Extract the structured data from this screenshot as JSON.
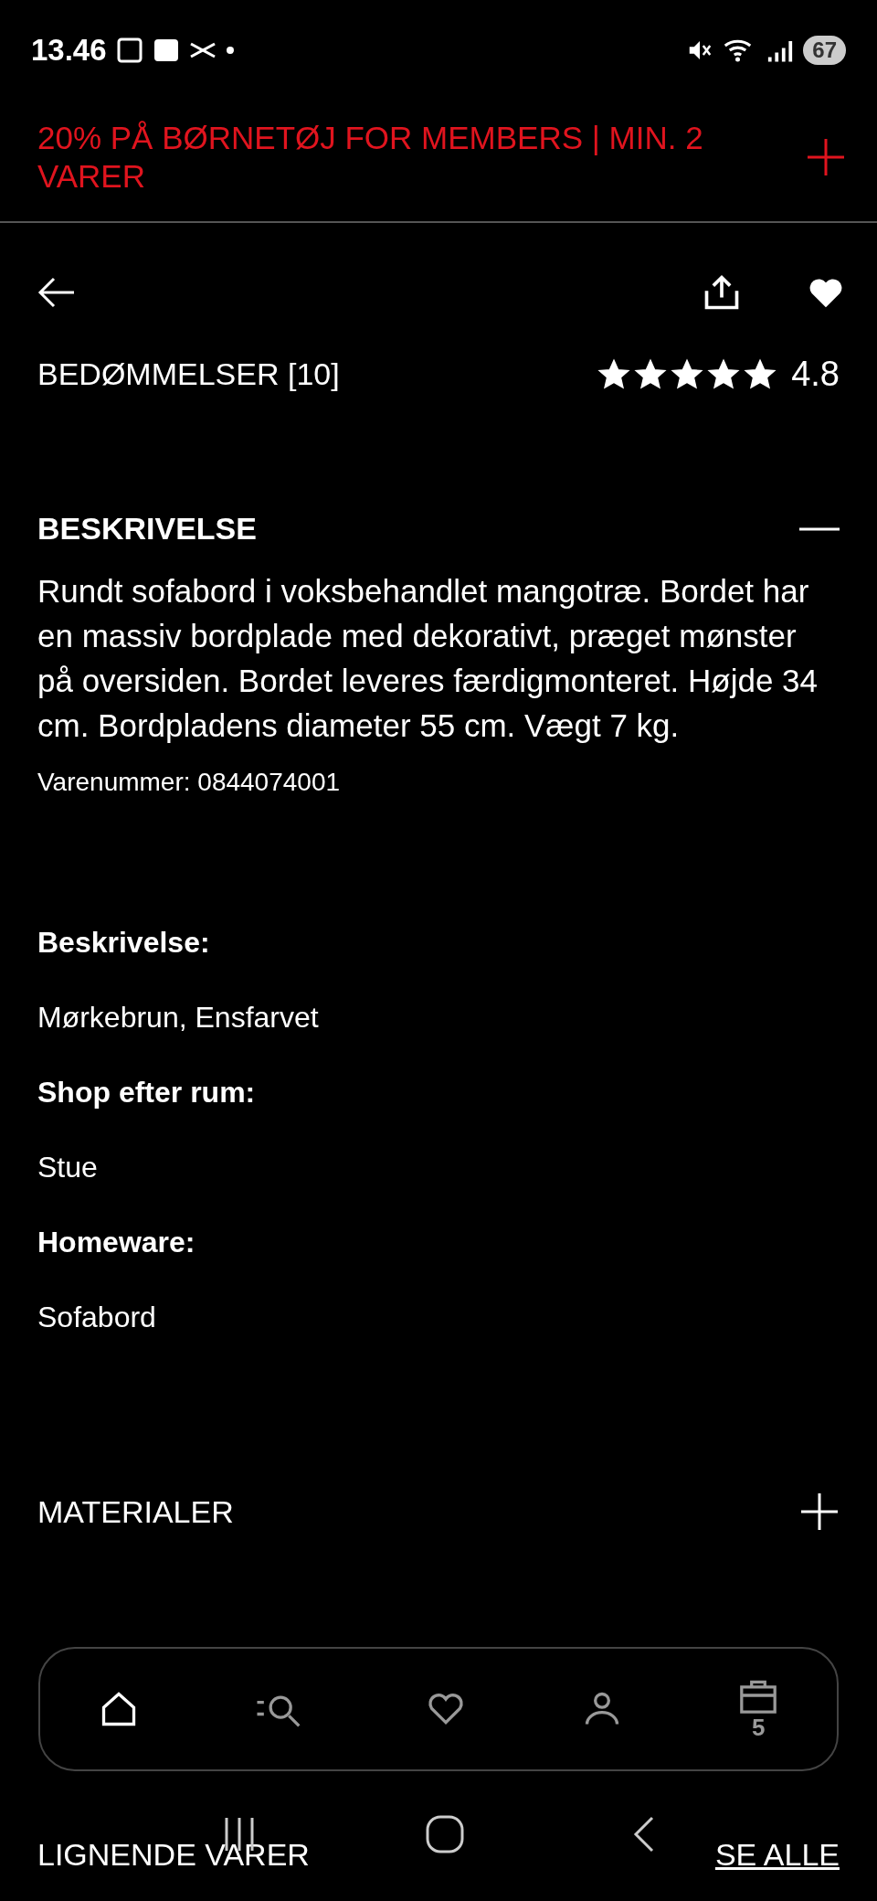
{
  "status_bar": {
    "time": "13.46",
    "battery": "67"
  },
  "promo": {
    "text": "20% PÅ BØRNETØJ FOR MEMBERS | MIN. 2 VARER",
    "expanded": false
  },
  "reviews": {
    "label": "BEDØMMELSER [10]",
    "stars": 5,
    "rating": "4.8"
  },
  "description": {
    "title": "BESKRIVELSE",
    "expanded": true,
    "text": "Rundt sofabord i voksbehandlet mangotræ. Bordet har en massiv bordplade med dekorativt, præget mønster på oversiden. Bordet leveres færdigmonteret. Højde 34 cm. Bordpladens diameter 55 cm. Vægt 7 kg.",
    "article_number": "Varenummer: 0844074001",
    "attributes": [
      {
        "label": "Beskrivelse:",
        "value": "Mørkebrun, Ensfarvet"
      },
      {
        "label": "Shop efter rum:",
        "value": "Stue"
      },
      {
        "label": "Homeware:",
        "value": "Sofabord"
      }
    ]
  },
  "sections": [
    {
      "title": "MATERIALER",
      "expanded": false
    }
  ],
  "bottom_nav": [
    {
      "kind": "home",
      "selected": true
    },
    {
      "kind": "search",
      "selected": false
    },
    {
      "kind": "favorites",
      "selected": false
    },
    {
      "kind": "account",
      "selected": false
    },
    {
      "kind": "bag",
      "selected": false,
      "badge": "5"
    }
  ],
  "similar": {
    "title": "LIGNENDE VARER",
    "link": "SE ALLE"
  }
}
